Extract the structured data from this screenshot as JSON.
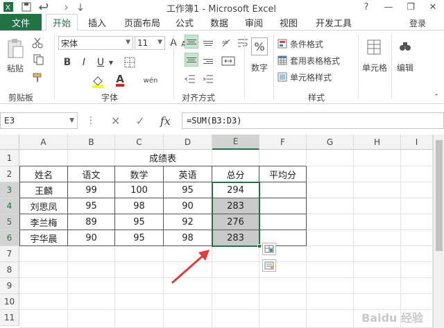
{
  "window": {
    "title": "工作簿1 - Microsoft Excel",
    "controls": [
      "?",
      "—",
      "❐",
      "✕"
    ]
  },
  "tabs": {
    "file": "文件",
    "items": [
      "开始",
      "插入",
      "页面布局",
      "公式",
      "数据",
      "审阅",
      "视图",
      "开发工具"
    ],
    "active": "开始",
    "login": "登录"
  },
  "ribbon": {
    "clipboard": {
      "label": "剪贴板",
      "paste": "粘贴"
    },
    "font": {
      "label": "字体",
      "name": "宋体",
      "size": "11",
      "bold": "B",
      "italic": "I",
      "underline": "U",
      "grow": "A",
      "shrink": "A",
      "font_color_letter": "A",
      "phonetic": "wén"
    },
    "alignment": {
      "label": "对齐方式"
    },
    "number": {
      "label": "数字",
      "symbol": "%"
    },
    "styles": {
      "label": "样式",
      "conditional": "条件格式",
      "table": "套用表格格式",
      "cell": "单元格样式"
    },
    "cells": {
      "label": "单元格"
    },
    "editing": {
      "label": "编辑"
    }
  },
  "formula_bar": {
    "name_box": "E3",
    "cancel": "✕",
    "enter": "✓",
    "fx": "fx",
    "formula": "=SUM(B3:D3)"
  },
  "grid": {
    "columns": [
      "A",
      "B",
      "C",
      "D",
      "E",
      "F",
      "G",
      "H",
      "I"
    ],
    "rows": [
      "1",
      "2",
      "3",
      "4",
      "5",
      "6",
      "7",
      "8",
      "9",
      "10",
      "11"
    ],
    "title": "成绩表",
    "headers": [
      "姓名",
      "语文",
      "数学",
      "英语",
      "总分",
      "平均分"
    ],
    "data": [
      [
        "王麟",
        "99",
        "100",
        "95",
        "294",
        ""
      ],
      [
        "刘思凤",
        "95",
        "98",
        "90",
        "283",
        ""
      ],
      [
        "李兰梅",
        "89",
        "95",
        "92",
        "276",
        ""
      ],
      [
        "宇华晨",
        "90",
        "95",
        "98",
        "283",
        ""
      ]
    ]
  },
  "watermark": "Baidu 经验",
  "colors": {
    "accent": "#217346",
    "selection_fill": "#c9c9c9",
    "arrow": "#e03a3a"
  }
}
